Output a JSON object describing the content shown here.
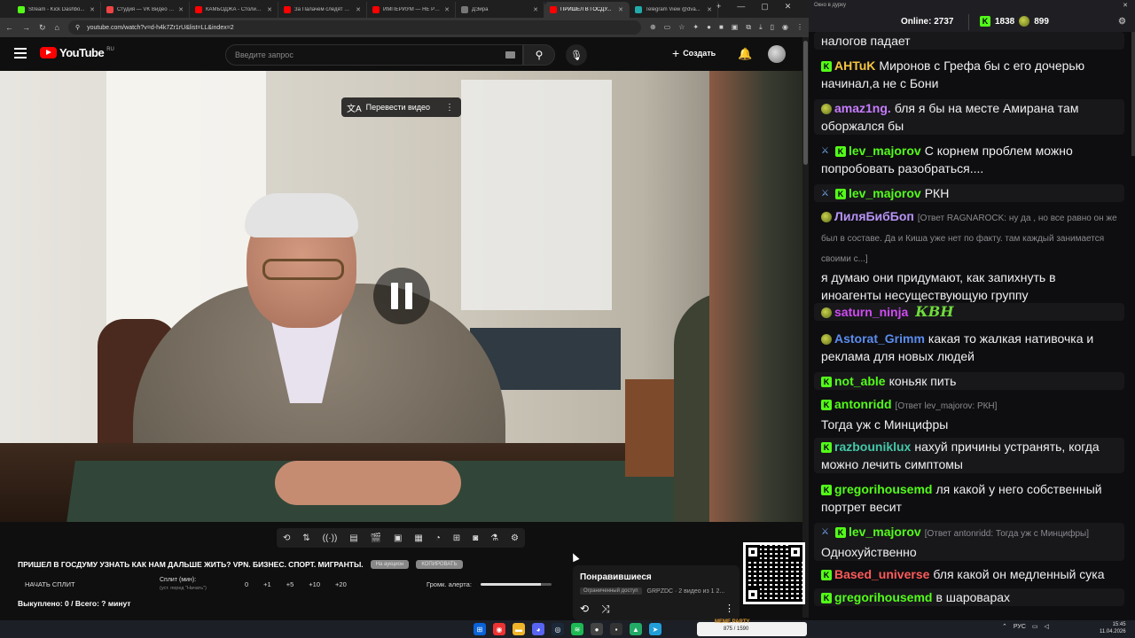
{
  "browser": {
    "tabs": [
      {
        "label": "Stream - Kick Dashbo...",
        "color": "#53fc18"
      },
      {
        "label": "Студия — VK Видео (...",
        "color": "#e44"
      },
      {
        "label": "КАМБОДЖА - Столиц...",
        "color": "#f00"
      },
      {
        "label": "За Палачем следят в ...",
        "color": "#f00"
      },
      {
        "label": "ИМПЕРИУМ — НЕ РО...",
        "color": "#f00"
      },
      {
        "label": "ДЭйра",
        "color": "#777"
      },
      {
        "label": "ПРИШЕЛ В ГОСДУ...",
        "color": "#f00",
        "active": true
      },
      {
        "label": "Telegram View @dva...",
        "color": "#2aa"
      }
    ],
    "url": "youtube.com/watch?v=d-h4k7Zr1rU&list=LL&index=2"
  },
  "youtube": {
    "logo_text": "YouTube",
    "country": "RU",
    "search_placeholder": "Введите запрос",
    "create_label": "Создать",
    "translate_label": "Перевести видео"
  },
  "extension": {
    "video_title": "ПРИШЕЛ В ГОСДУМУ УЗНАТЬ КАК НАМ ДАЛЬШЕ ЖИТЬ? VPN. БИЗНЕС. СПОРТ. МИГРАНТЫ.",
    "pill1": "На аукцион",
    "pill2": "КОПИРОВАТЬ",
    "start_split": "НАЧАТЬ СПЛИТ",
    "split_label": "Сплит (мин):",
    "split_hint": "(уст. перед \"Начать\")",
    "split_values": [
      "0",
      "+1",
      "+5",
      "+10",
      "+20"
    ],
    "alert_label": "Громк. алерта:",
    "alert_volume": 0.85,
    "bought": "Выкуплено: 0 / Всего: ? минут"
  },
  "playlist": {
    "title": "Понравившиеся",
    "access": "Ограниченный доступ",
    "meta": "GRPZDC · 2 видео из 1 2..."
  },
  "chat": {
    "window_title": "Окно в дуpку",
    "online_label": "Online:",
    "online_count": "2737",
    "kick_count": "1838",
    "other_count": "899",
    "messages": [
      {
        "user": "",
        "badges": [],
        "text": "налогов падает",
        "color": "#fff"
      },
      {
        "user": "AHTuK",
        "badges": [
          "kick"
        ],
        "text": "Миронов с Грефа бы с его дочерью начинал,а не с Бони",
        "color": "#f5c542"
      },
      {
        "user": "amaz1ng.",
        "badges": [
          "pepe"
        ],
        "text": "бля я бы на месте Амирана там обоpжался бы",
        "color": "#c77dff"
      },
      {
        "user": "lev_majorov",
        "badges": [
          "sword",
          "kick"
        ],
        "text": "С корнем проблем можно попробовать разобраться....",
        "color": "#53fc18"
      },
      {
        "user": "lev_majorov",
        "badges": [
          "sword",
          "kick"
        ],
        "text": "РКН",
        "color": "#53fc18"
      },
      {
        "user": "ЛиляБибБоп",
        "badges": [
          "pepe"
        ],
        "reply": "[Ответ RAGNAROCK: ну да , но все равно он же был в составе. Да и Киша уже нет по факту. там каждый занимается своими с...]",
        "text": "я думаю они придумают, как запихнуть в иноагенты несуществующую группу",
        "color": "#b794f6"
      },
      {
        "user": "saturn_ninja",
        "badges": [
          "pepe"
        ],
        "text": "",
        "emote": "КВН",
        "color": "#d04bf2"
      },
      {
        "user": "Astorat_Grimm",
        "badges": [
          "pepe"
        ],
        "text": "какая то жалкая нативочка и реклама для новых людей",
        "color": "#5b8def"
      },
      {
        "user": "not_able",
        "badges": [
          "kick"
        ],
        "text": "коньяк пить",
        "color": "#53fc18"
      },
      {
        "user": "antonridd",
        "badges": [
          "kick"
        ],
        "reply": "[Ответ lev_majorov: РКН]",
        "text": "Тогда уж с Минцифры",
        "color": "#53fc18"
      },
      {
        "user": "razbouniklux",
        "badges": [
          "kick"
        ],
        "text": "нахуй причины устранять, когда можно лечить симптомы",
        "color": "#43c7a8"
      },
      {
        "user": "gregorihousemd",
        "badges": [
          "kick"
        ],
        "text": "ля какой у него собственный портрет весит",
        "color": "#53fc18"
      },
      {
        "user": "lev_majorov",
        "badges": [
          "sword",
          "kick"
        ],
        "reply": "[Ответ antonridd: Тогда уж с Минцифры]",
        "text": "Однохуйственно",
        "color": "#53fc18"
      },
      {
        "user": "Based_universe",
        "badges": [
          "kick"
        ],
        "text": "бля какой он медленный сука",
        "color": "#ff5a5a"
      },
      {
        "user": "gregorihousemd",
        "badges": [
          "kick"
        ],
        "text": "в шароварах",
        "color": "#53fc18"
      }
    ]
  },
  "taskbar": {
    "meme_title": "MEME PARTY",
    "meme_count": "875 / 1590",
    "lang": "РУС",
    "time": "15:45",
    "date": "11.04.2026"
  }
}
